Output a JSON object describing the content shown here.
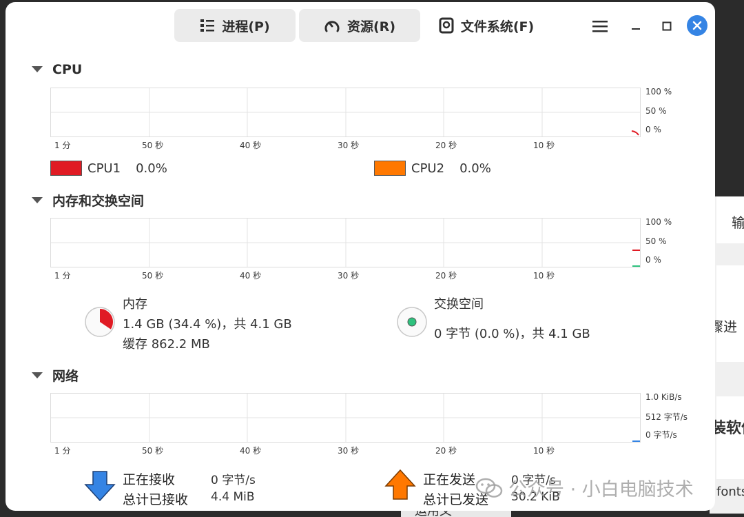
{
  "tabs": [
    {
      "label": "进程(P)",
      "icon": "list-icon"
    },
    {
      "label": "资源(R)",
      "icon": "gauge-icon"
    },
    {
      "label": "文件系统(F)",
      "icon": "disk-icon"
    }
  ],
  "sections": {
    "cpu": "CPU",
    "memory": "内存和交换空间",
    "network": "网络"
  },
  "x_ticks": [
    "1 分",
    "50 秒",
    "40 秒",
    "30 秒",
    "20 秒",
    "10 秒"
  ],
  "cpu": {
    "y_ticks": [
      "100 %",
      "50 %",
      "0 %"
    ],
    "legend": [
      {
        "name": "CPU1",
        "value": "0.0%",
        "color": "#e01b24"
      },
      {
        "name": "CPU2",
        "value": "0.0%",
        "color": "#ff7800"
      }
    ]
  },
  "memory": {
    "y_ticks": [
      "100 %",
      "50 %",
      "0 %"
    ],
    "mem": {
      "title": "内存",
      "usage": "1.4 GB (34.4 %)，共 4.1 GB",
      "cache": "缓存 862.2 MB",
      "fraction": 0.344,
      "color": "#e01b24"
    },
    "swap": {
      "title": "交换空间",
      "usage": "0 字节 (0.0 %)，共 4.1 GB",
      "fraction": 0.0,
      "color": "#2ec27e"
    }
  },
  "network": {
    "y_ticks": [
      "1.0 KiB/s",
      "512 字节/s",
      "0 字节/s"
    ],
    "receiving_label": "正在接收",
    "receiving_value": "0 字节/s",
    "total_received_label": "总计已接收",
    "total_received_value": "4.4 MiB",
    "sending_label": "正在发送",
    "sending_value": "0 字节/s",
    "total_sent_label": "总计已发送",
    "total_sent_value": "30.2 KiB"
  },
  "background": {
    "side_texts": [
      "输",
      "骤进",
      "装软件",
      "fonts"
    ],
    "bottom_text": "运用文"
  },
  "watermark": "公众号 · 小白电脑技术"
}
